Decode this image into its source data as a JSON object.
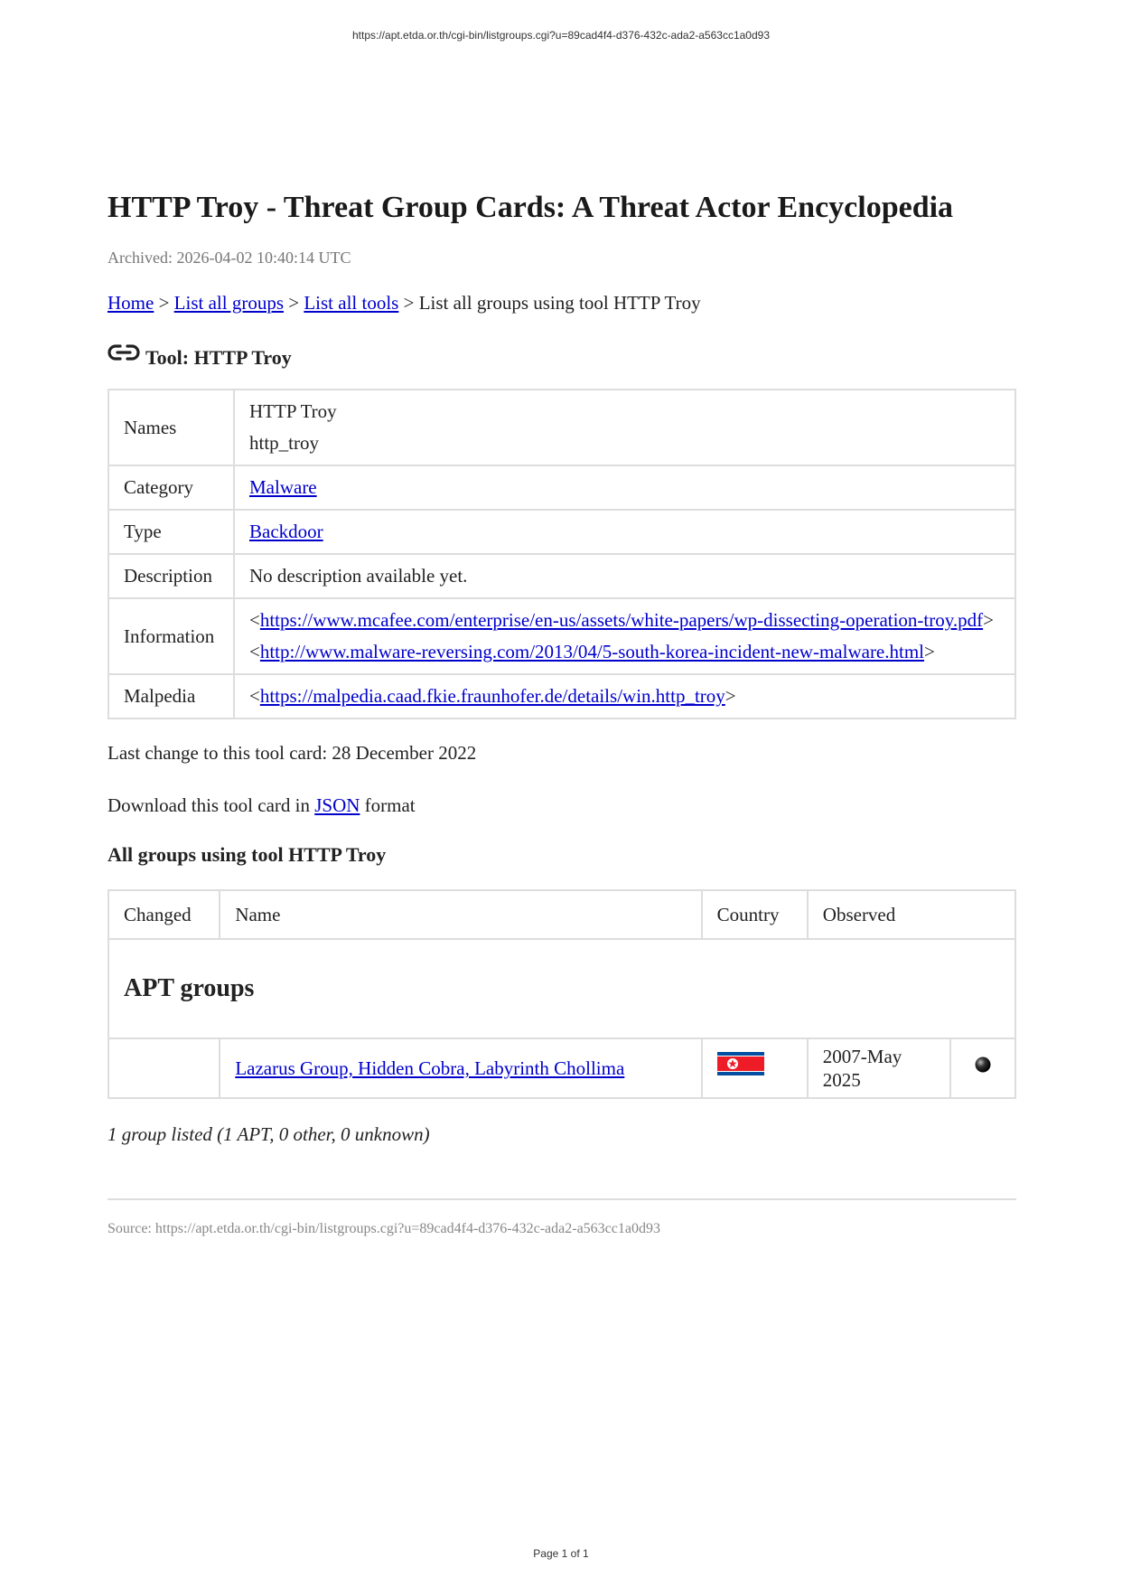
{
  "print": {
    "header_url": "https://apt.etda.or.th/cgi-bin/listgroups.cgi?u=89cad4f4-d376-432c-ada2-a563cc1a0d93",
    "footer": "Page 1 of 1"
  },
  "page": {
    "title": "HTTP Troy - Threat Group Cards: A Threat Actor Encyclopedia",
    "archived": "Archived: 2026-04-02 10:40:14 UTC"
  },
  "breadcrumb": {
    "home": "Home",
    "sep": ">",
    "list_groups": "List all groups",
    "list_tools": "List all tools",
    "current": "List all groups using tool HTTP Troy"
  },
  "tool": {
    "heading": "Tool: HTTP Troy",
    "heading_icon": "link-icon",
    "rows": {
      "names": {
        "label": "Names",
        "values": [
          "HTTP Troy",
          "http_troy"
        ]
      },
      "category": {
        "label": "Category",
        "value": "Malware"
      },
      "type": {
        "label": "Type",
        "value": "Backdoor"
      },
      "description": {
        "label": "Description",
        "value": "No description available yet."
      },
      "information": {
        "label": "Information",
        "lt": "<",
        "gt": ">",
        "links": [
          "https://www.mcafee.com/enterprise/en-us/assets/white-papers/wp-dissecting-operation-troy.pdf",
          "http://www.malware-reversing.com/2013/04/5-south-korea-incident-new-malware.html"
        ]
      },
      "malpedia": {
        "label": "Malpedia",
        "link": "https://malpedia.caad.fkie.fraunhofer.de/details/win.http_troy"
      }
    }
  },
  "last_change": "Last change to this tool card: 28 December 2022",
  "download": {
    "prefix": "Download this tool card in",
    "link": "JSON",
    "suffix": "format"
  },
  "groups": {
    "heading": "All groups using tool HTTP Troy",
    "columns": {
      "changed": "Changed",
      "name": "Name",
      "country": "Country",
      "observed": "Observed"
    },
    "section": "APT groups",
    "rows": [
      {
        "changed": "",
        "name": "Lazarus Group, Hidden Cobra, Labyrinth Chollima",
        "country_icon": "north-korea-flag-icon",
        "observed": "2007-May 2025",
        "status_icon": "black-circle-icon"
      }
    ],
    "summary": "1 group listed (1 APT, 0 other, 0 unknown)"
  },
  "source": "Source: https://apt.etda.or.th/cgi-bin/listgroups.cgi?u=89cad4f4-d376-432c-ada2-a563cc1a0d93",
  "colors": {
    "link": "#0000cc",
    "border": "#dddddd",
    "muted_text": "#777777",
    "flag_blue": "#024fa2",
    "flag_red": "#ed1c27"
  }
}
